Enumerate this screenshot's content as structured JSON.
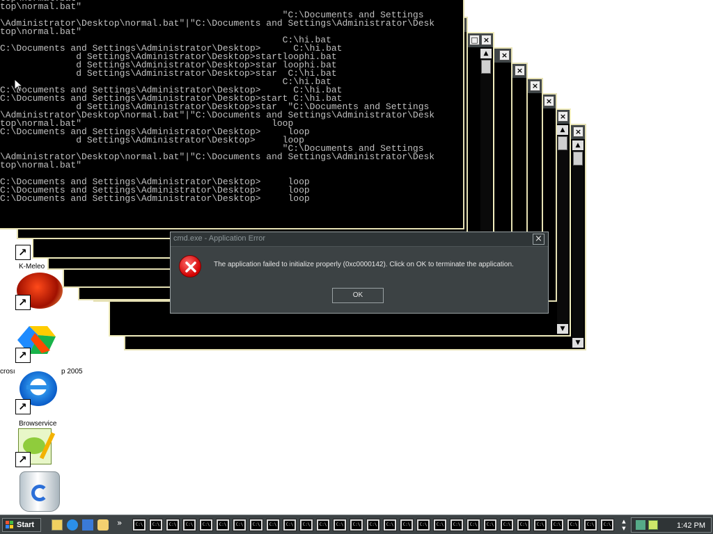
{
  "console_lines": [
    "top\\normal.bat\"",
    "top\\normal.bat\"",
    "                                                    \"C:\\Documents and Settings",
    "\\Administrator\\Desktop\\normal.bat\"|\"C:\\Documents and Settings\\Administrator\\Desk",
    "top\\normal.bat\"",
    "                                                    C:\\hi.bat",
    "C:\\Documents and Settings\\Administrator\\Desktop>      C:\\hi.bat",
    "              d Settings\\Administrator\\Desktop>startloophi.bat",
    "              d Settings\\Administrator\\Desktop>star loophi.bat",
    "              d Settings\\Administrator\\Desktop>star  C:\\hi.bat",
    "                                                    C:\\hi.bat",
    "C:\\Documents and Settings\\Administrator\\Desktop>      C:\\hi.bat",
    "C:\\Documents and Settings\\Administrator\\Desktop>start C:\\hi.bat",
    "              d Settings\\Administrator\\Desktop>star  \"C:\\Documents and Settings",
    "\\Administrator\\Desktop\\normal.bat\"|\"C:\\Documents and Settings\\Administrator\\Desk",
    "top\\normal.bat\"                                   loop",
    "C:\\Documents and Settings\\Administrator\\Desktop>     loop",
    "              d Settings\\Administrator\\Desktop>     loop",
    "                                                    \"C:\\Documents and Settings",
    "\\Administrator\\Desktop\\normal.bat\"|\"C:\\Documents and Settings\\Administrator\\Desk",
    "top\\normal.bat\"",
    "",
    "C:\\Documents and Settings\\Administrator\\Desktop>     loop",
    "C:\\Documents and Settings\\Administrator\\Desktop>     loop",
    "C:\\Documents and Settings\\Administrator\\Desktop>     loop"
  ],
  "dialog": {
    "title": "cmd.exe - Application Error",
    "message": "The application failed to initialize properly (0xc0000142). Click on OK to terminate the application.",
    "ok_label": "OK",
    "close_glyph": "×"
  },
  "desktop_icons": [
    {
      "label": "K-Meleo",
      "icon": "k-meleo-icon"
    },
    {
      "label": "",
      "icon": "red-ball-icon"
    },
    {
      "label": "crosoft ... p 2005",
      "icon": "visual-studio-icon"
    },
    {
      "label": "Browservice",
      "icon": "internet-explorer-icon"
    },
    {
      "label": "",
      "icon": "notepad-plus-icon"
    },
    {
      "label": "",
      "icon": "recycle-bin-icon"
    }
  ],
  "icon_labels": {
    "kmeleo": "K-Meleo",
    "vs_left": "crosı",
    "vs_right": "p 2005",
    "browservice": "Browservice"
  },
  "taskbar": {
    "start_label": "Start",
    "chevron": "»",
    "task_glyph": "C:\\",
    "clock": "1:42 PM"
  },
  "window_controls": {
    "min": "_",
    "max": "□",
    "close": "×"
  },
  "colors": {
    "console_bg": "#000000",
    "console_text": "#c0c0c0",
    "window_border": "#e6e1b4",
    "dialog_bg": "#3c4244",
    "taskbar_bg": "#3d4345",
    "error_red": "#d00000"
  }
}
